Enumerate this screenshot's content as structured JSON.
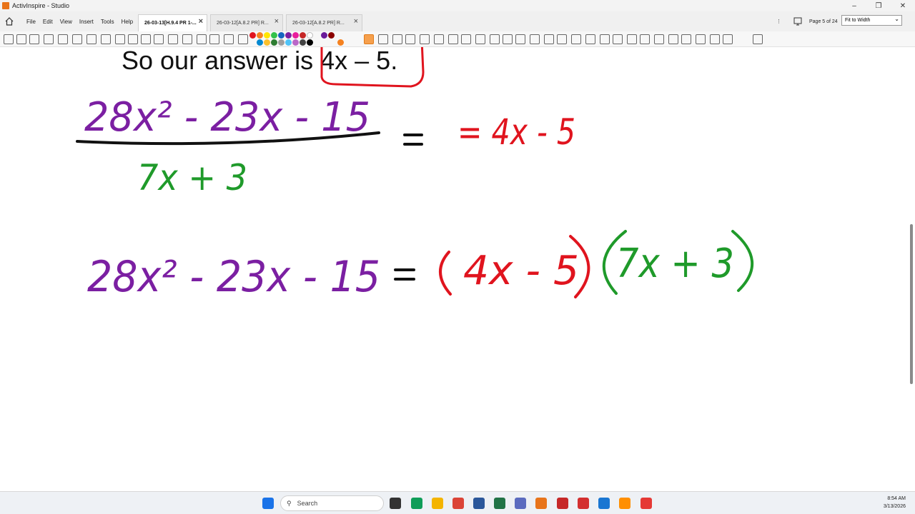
{
  "window": {
    "title": "ActivInspire - Studio"
  },
  "menu": {
    "items": [
      "File",
      "Edit",
      "View",
      "Insert",
      "Tools",
      "Help"
    ]
  },
  "tabs": [
    {
      "label": "26-03-13[H.9.4 PR 1-...",
      "active": true
    },
    {
      "label": "26-03-12[A.8.2 PR] R...",
      "active": false
    },
    {
      "label": "26-03-12[A.8.2 PR] R...",
      "active": false
    }
  ],
  "page_nav": {
    "page_label": "Page 5 of 24",
    "zoom": "Fit to Width"
  },
  "flipchart": {
    "answer_text": "So our answer is 4x – 5.",
    "fraction_numerator": "28x² - 23x - 15",
    "fraction_denominator": "7x + 3",
    "fraction_result": "= 4x - 5",
    "factored_lhs": "28x² - 23x - 15",
    "factored_rhs": "= (4x - 5)(7x + 3)"
  },
  "colors": {
    "purple": "#7b1fa2",
    "red": "#e0141e",
    "green": "#1f9a2a",
    "black": "#111111"
  },
  "taskbar": {
    "search_placeholder": "Search",
    "time": "8:54 AM",
    "date": "3/13/2026"
  }
}
